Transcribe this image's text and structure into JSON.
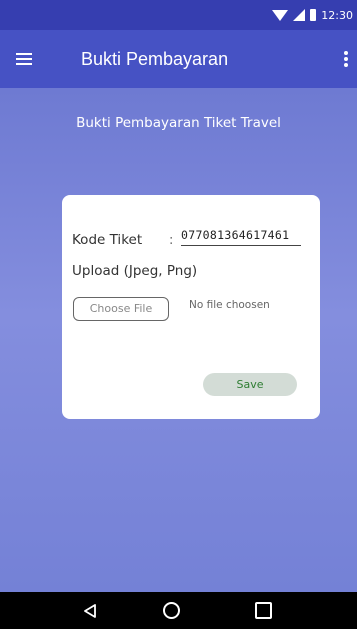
{
  "status_bar": {
    "time": "12:30"
  },
  "app_bar": {
    "title": "Bukti Pembayaran"
  },
  "content": {
    "subtitle": "Bukti Pembayaran Tiket Travel",
    "kode_label": "Kode Tiket",
    "kode_colon": ":",
    "kode_value": "077081364617461",
    "upload_label": "Upload (Jpeg, Png)",
    "choose_file_label": "Choose File",
    "no_file_text": "No file choosen",
    "save_label": "Save"
  },
  "colors": {
    "status_bar": "#363eb0",
    "app_bar": "#4652c4",
    "background_gradient": "#848ede",
    "save_button_bg": "#d3dcd6",
    "save_button_text": "#2e7d32"
  },
  "icons": {
    "status": [
      "wifi-icon",
      "signal-icon",
      "battery-icon"
    ],
    "app_bar": [
      "menu-icon",
      "more-vert-icon"
    ],
    "nav": [
      "back-icon",
      "home-icon",
      "recent-apps-icon"
    ]
  }
}
